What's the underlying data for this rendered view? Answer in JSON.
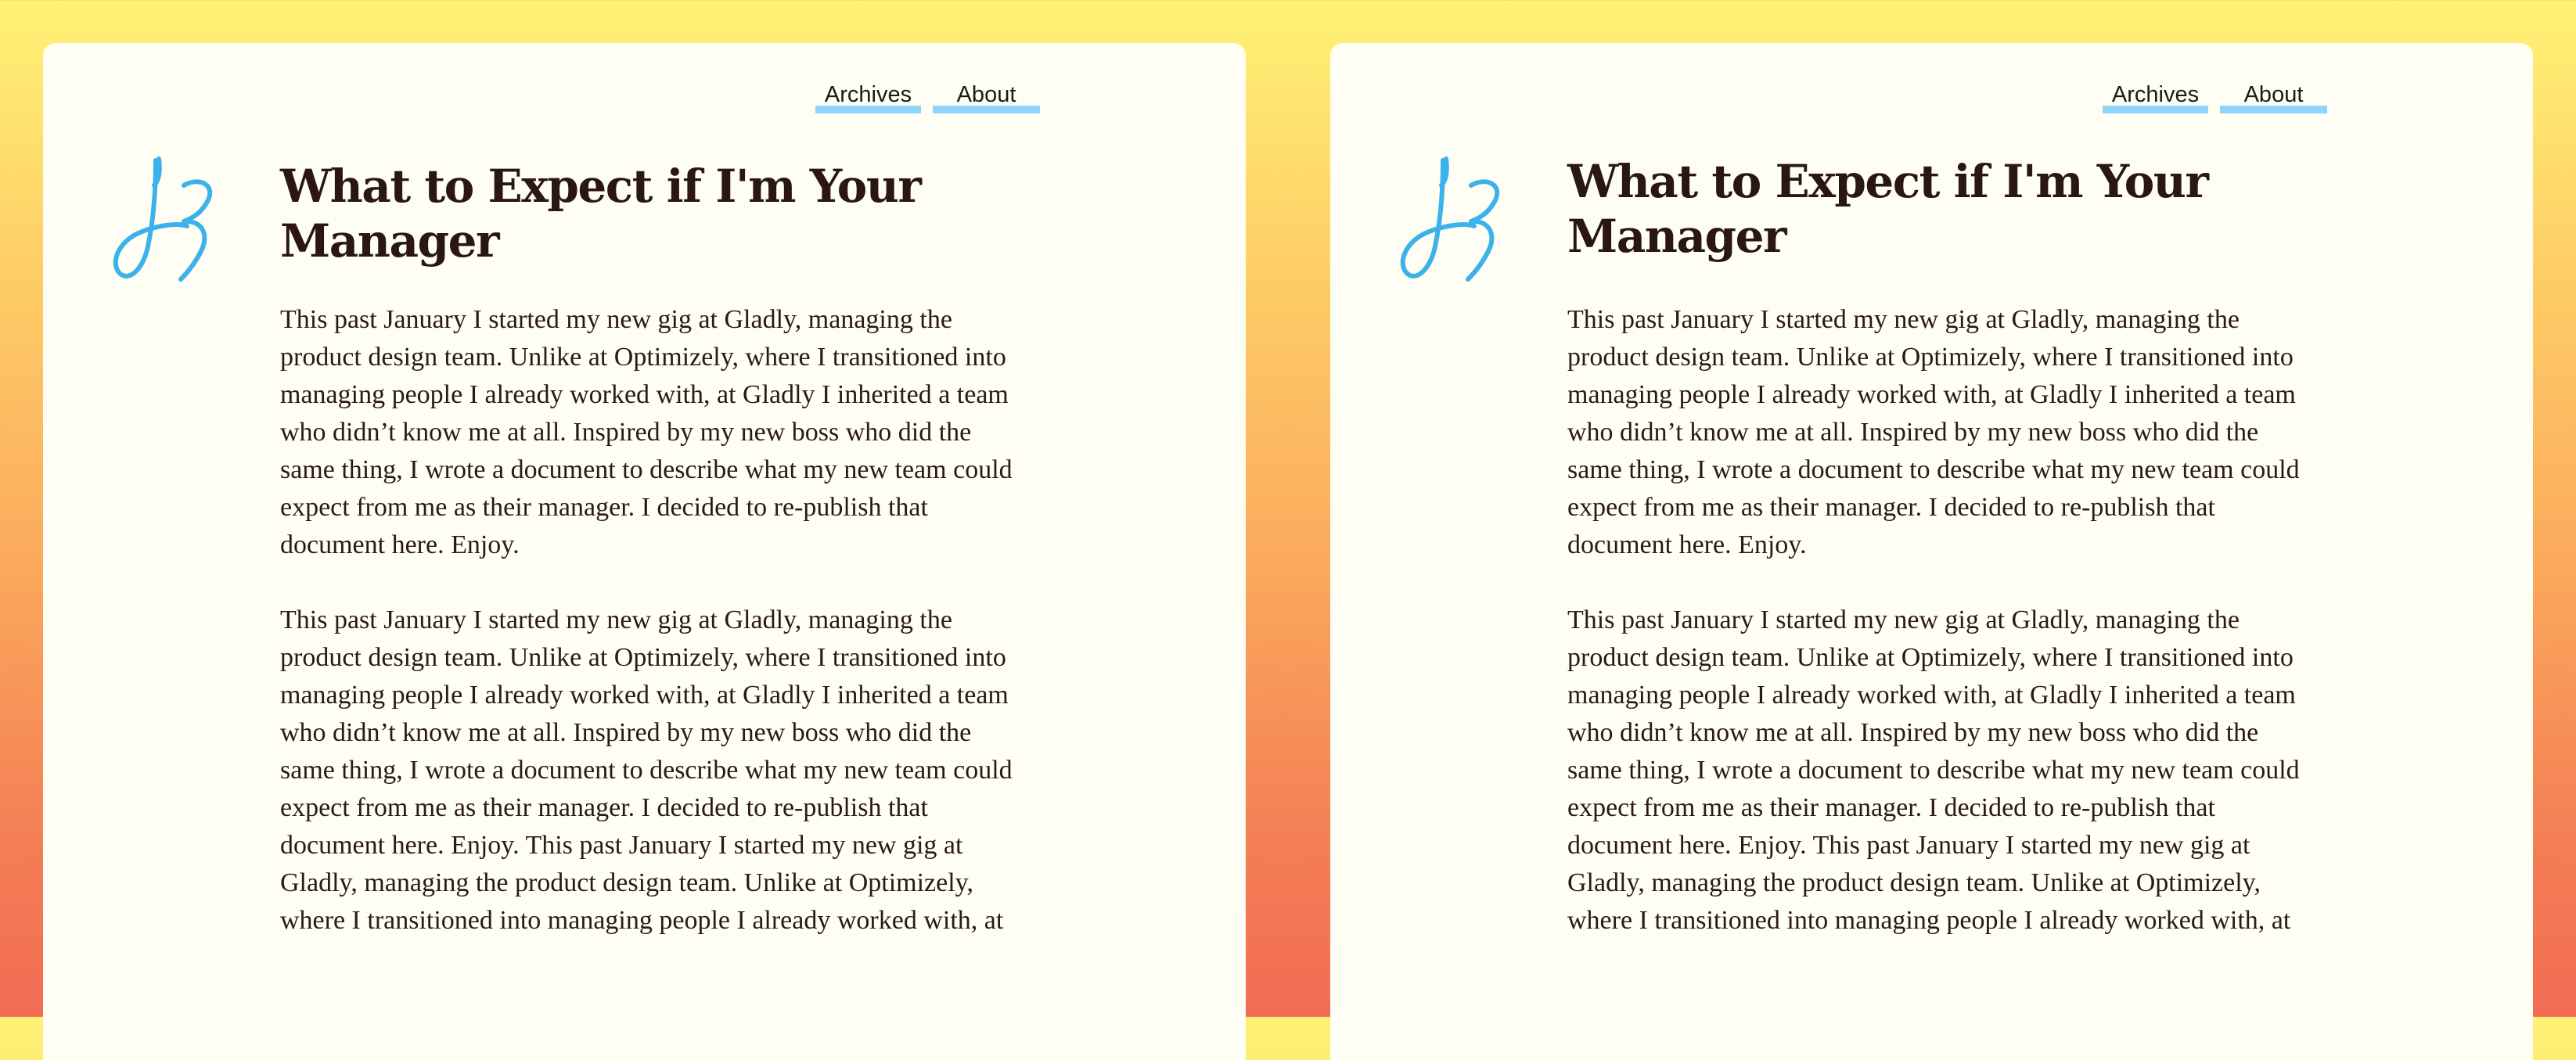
{
  "panels": [
    {
      "nav": [
        {
          "label": "Archives"
        },
        {
          "label": "About"
        }
      ],
      "logo": {
        "icon": "jz-signature-logo"
      },
      "title": "What to Expect if I'm Your\nManager",
      "paragraphs": [
        "This past January I started my new gig at Gladly, managing the\nproduct design team. Unlike at Optimizely, where I transitioned into\nmanaging people I already worked with, at Gladly I inherited a team\nwho didn’t know me at all. Inspired by my new boss who did the\nsame thing, I wrote a document to describe what my new team could\nexpect from me as their manager. I decided to re-publish that\ndocument here. Enjoy.",
        "This past January I started my new gig at Gladly, managing the\nproduct design team. Unlike at Optimizely, where I transitioned into\nmanaging people I already worked with, at Gladly I inherited a team\nwho didn’t know me at all. Inspired by my new boss who did the\nsame thing, I wrote a document to describe what my new team could\nexpect from me as their manager. I decided to re-publish that\ndocument here. Enjoy. This past January I started my new gig at\nGladly, managing the product design team. Unlike at Optimizely,\nwhere I transitioned into managing people I already worked with, at"
      ]
    },
    {
      "nav": [
        {
          "label": "Archives"
        },
        {
          "label": "About"
        }
      ],
      "logo": {
        "icon": "jz-signature-logo"
      },
      "title": "What to Expect if I'm Your\nManager",
      "paragraphs": [
        "This past January I started my new gig at Gladly, managing the\nproduct design team. Unlike at Optimizely, where I transitioned into\nmanaging people I already worked with, at Gladly I inherited a team\nwho didn’t know me at all. Inspired by my new boss who did the\nsame thing, I wrote a document to describe what my new team could\nexpect from me as their manager. I decided to re-publish that\ndocument here. Enjoy.",
        "This past January I started my new gig at Gladly, managing the\nproduct design team. Unlike at Optimizely, where I transitioned into\nmanaging people I already worked with, at Gladly I inherited a team\nwho didn’t know me at all. Inspired by my new boss who did the\nsame thing, I wrote a document to describe what my new team could\nexpect from me as their manager. I decided to re-publish that\ndocument here. Enjoy. This past January I started my new gig at\nGladly, managing the product design team. Unlike at Optimizely,\nwhere I transitioned into managing people I already worked with, at"
      ]
    }
  ],
  "colors": {
    "background_top": "#fff275",
    "background_bottom": "#f26c54",
    "panel": "#fffef4",
    "nav_underline": "#8fd4fb",
    "logo": "#3bb2ea",
    "title": "#2b1711",
    "body_text": "#2a1a14"
  }
}
